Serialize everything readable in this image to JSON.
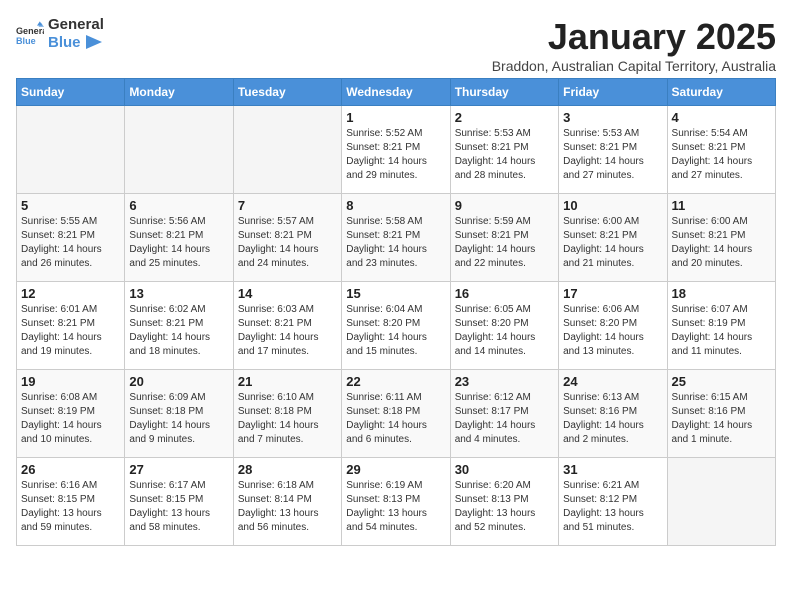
{
  "header": {
    "logo_general": "General",
    "logo_blue": "Blue",
    "month_title": "January 2025",
    "subtitle": "Braddon, Australian Capital Territory, Australia"
  },
  "days_of_week": [
    "Sunday",
    "Monday",
    "Tuesday",
    "Wednesday",
    "Thursday",
    "Friday",
    "Saturday"
  ],
  "weeks": [
    [
      {
        "day": "",
        "info": ""
      },
      {
        "day": "",
        "info": ""
      },
      {
        "day": "",
        "info": ""
      },
      {
        "day": "1",
        "info": "Sunrise: 5:52 AM\nSunset: 8:21 PM\nDaylight: 14 hours\nand 29 minutes."
      },
      {
        "day": "2",
        "info": "Sunrise: 5:53 AM\nSunset: 8:21 PM\nDaylight: 14 hours\nand 28 minutes."
      },
      {
        "day": "3",
        "info": "Sunrise: 5:53 AM\nSunset: 8:21 PM\nDaylight: 14 hours\nand 27 minutes."
      },
      {
        "day": "4",
        "info": "Sunrise: 5:54 AM\nSunset: 8:21 PM\nDaylight: 14 hours\nand 27 minutes."
      }
    ],
    [
      {
        "day": "5",
        "info": "Sunrise: 5:55 AM\nSunset: 8:21 PM\nDaylight: 14 hours\nand 26 minutes."
      },
      {
        "day": "6",
        "info": "Sunrise: 5:56 AM\nSunset: 8:21 PM\nDaylight: 14 hours\nand 25 minutes."
      },
      {
        "day": "7",
        "info": "Sunrise: 5:57 AM\nSunset: 8:21 PM\nDaylight: 14 hours\nand 24 minutes."
      },
      {
        "day": "8",
        "info": "Sunrise: 5:58 AM\nSunset: 8:21 PM\nDaylight: 14 hours\nand 23 minutes."
      },
      {
        "day": "9",
        "info": "Sunrise: 5:59 AM\nSunset: 8:21 PM\nDaylight: 14 hours\nand 22 minutes."
      },
      {
        "day": "10",
        "info": "Sunrise: 6:00 AM\nSunset: 8:21 PM\nDaylight: 14 hours\nand 21 minutes."
      },
      {
        "day": "11",
        "info": "Sunrise: 6:00 AM\nSunset: 8:21 PM\nDaylight: 14 hours\nand 20 minutes."
      }
    ],
    [
      {
        "day": "12",
        "info": "Sunrise: 6:01 AM\nSunset: 8:21 PM\nDaylight: 14 hours\nand 19 minutes."
      },
      {
        "day": "13",
        "info": "Sunrise: 6:02 AM\nSunset: 8:21 PM\nDaylight: 14 hours\nand 18 minutes."
      },
      {
        "day": "14",
        "info": "Sunrise: 6:03 AM\nSunset: 8:21 PM\nDaylight: 14 hours\nand 17 minutes."
      },
      {
        "day": "15",
        "info": "Sunrise: 6:04 AM\nSunset: 8:20 PM\nDaylight: 14 hours\nand 15 minutes."
      },
      {
        "day": "16",
        "info": "Sunrise: 6:05 AM\nSunset: 8:20 PM\nDaylight: 14 hours\nand 14 minutes."
      },
      {
        "day": "17",
        "info": "Sunrise: 6:06 AM\nSunset: 8:20 PM\nDaylight: 14 hours\nand 13 minutes."
      },
      {
        "day": "18",
        "info": "Sunrise: 6:07 AM\nSunset: 8:19 PM\nDaylight: 14 hours\nand 11 minutes."
      }
    ],
    [
      {
        "day": "19",
        "info": "Sunrise: 6:08 AM\nSunset: 8:19 PM\nDaylight: 14 hours\nand 10 minutes."
      },
      {
        "day": "20",
        "info": "Sunrise: 6:09 AM\nSunset: 8:18 PM\nDaylight: 14 hours\nand 9 minutes."
      },
      {
        "day": "21",
        "info": "Sunrise: 6:10 AM\nSunset: 8:18 PM\nDaylight: 14 hours\nand 7 minutes."
      },
      {
        "day": "22",
        "info": "Sunrise: 6:11 AM\nSunset: 8:18 PM\nDaylight: 14 hours\nand 6 minutes."
      },
      {
        "day": "23",
        "info": "Sunrise: 6:12 AM\nSunset: 8:17 PM\nDaylight: 14 hours\nand 4 minutes."
      },
      {
        "day": "24",
        "info": "Sunrise: 6:13 AM\nSunset: 8:16 PM\nDaylight: 14 hours\nand 2 minutes."
      },
      {
        "day": "25",
        "info": "Sunrise: 6:15 AM\nSunset: 8:16 PM\nDaylight: 14 hours\nand 1 minute."
      }
    ],
    [
      {
        "day": "26",
        "info": "Sunrise: 6:16 AM\nSunset: 8:15 PM\nDaylight: 13 hours\nand 59 minutes."
      },
      {
        "day": "27",
        "info": "Sunrise: 6:17 AM\nSunset: 8:15 PM\nDaylight: 13 hours\nand 58 minutes."
      },
      {
        "day": "28",
        "info": "Sunrise: 6:18 AM\nSunset: 8:14 PM\nDaylight: 13 hours\nand 56 minutes."
      },
      {
        "day": "29",
        "info": "Sunrise: 6:19 AM\nSunset: 8:13 PM\nDaylight: 13 hours\nand 54 minutes."
      },
      {
        "day": "30",
        "info": "Sunrise: 6:20 AM\nSunset: 8:13 PM\nDaylight: 13 hours\nand 52 minutes."
      },
      {
        "day": "31",
        "info": "Sunrise: 6:21 AM\nSunset: 8:12 PM\nDaylight: 13 hours\nand 51 minutes."
      },
      {
        "day": "",
        "info": ""
      }
    ]
  ]
}
